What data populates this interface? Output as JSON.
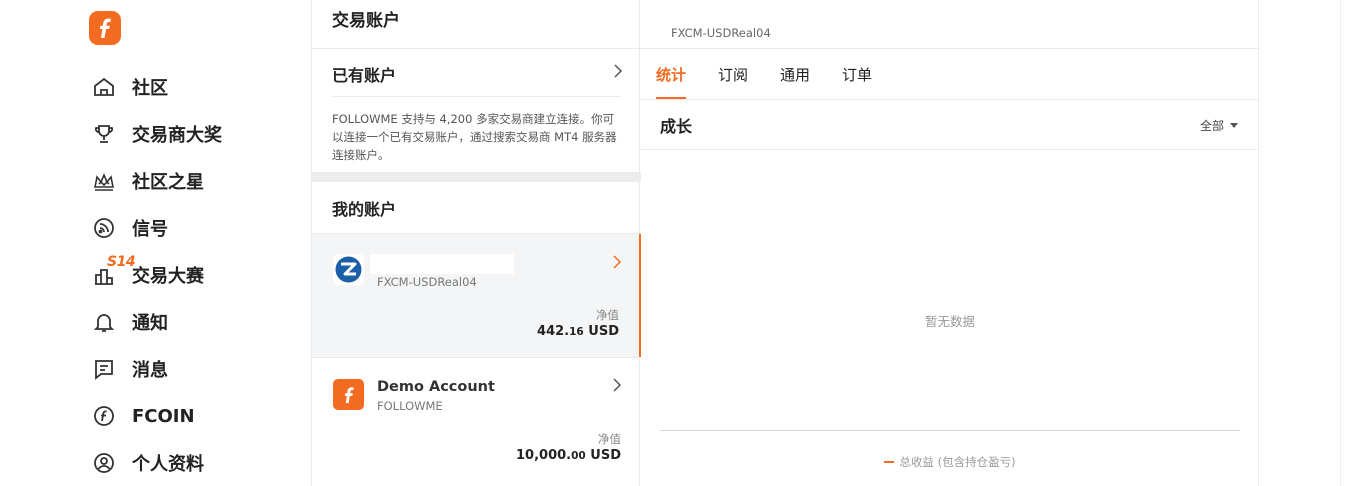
{
  "nav": {
    "items": [
      {
        "label": "社区",
        "icon": "home-icon"
      },
      {
        "label": "交易商大奖",
        "icon": "trophy-icon"
      },
      {
        "label": "社区之星",
        "icon": "crown-icon"
      },
      {
        "label": "信号",
        "icon": "signal-icon"
      },
      {
        "label": "交易大赛",
        "icon": "contest-icon",
        "badge": "S14"
      },
      {
        "label": "通知",
        "icon": "bell-icon"
      },
      {
        "label": "消息",
        "icon": "message-icon"
      },
      {
        "label": "FCOIN",
        "icon": "fcoin-icon"
      },
      {
        "label": "个人资料",
        "icon": "profile-icon"
      }
    ]
  },
  "middle": {
    "title": "交易账户",
    "existing_account": {
      "label": "已有账户",
      "description": "FOLLOWME 支持与 4,200 多家交易商建立连接。你可以连接一个已有交易账户，通过搜索交易商 MT4 服务器连接账户。"
    },
    "my_accounts_title": "我的账户",
    "accounts": [
      {
        "name": "",
        "server": "FXCM-USDReal04",
        "equity_label": "净值",
        "equity_int": "442.",
        "equity_dec": "16",
        "currency": " USD"
      },
      {
        "name": "Demo Account",
        "server": "FOLLOWME",
        "equity_label": "净值",
        "equity_int": "10,000.",
        "equity_dec": "00",
        "currency": " USD"
      }
    ]
  },
  "right": {
    "account_name": "FXCM-USDReal04",
    "tabs": [
      "统计",
      "订阅",
      "通用",
      "订单"
    ],
    "growth_title": "成长",
    "range_value": "全部",
    "no_data": "暂无数据",
    "legend": "总收益 (包含持仓盈亏)"
  },
  "colors": {
    "accent": "#f26b21",
    "fxcm_blue": "#1a5fa8"
  }
}
